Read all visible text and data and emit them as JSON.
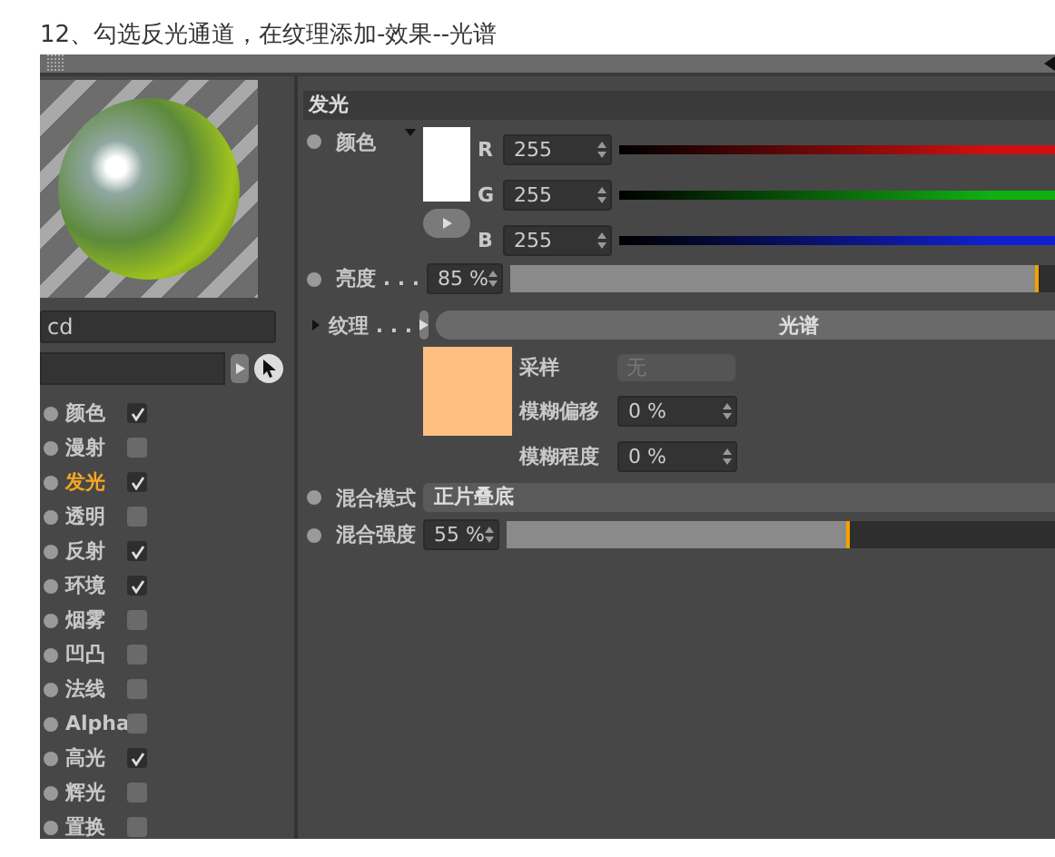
{
  "caption": "12、勾选反光通道，在纹理添加-效果--光谱",
  "material": {
    "name": "cd"
  },
  "channels": [
    {
      "label": "颜色",
      "checked": true,
      "selected": false
    },
    {
      "label": "漫射",
      "checked": false,
      "selected": false
    },
    {
      "label": "发光",
      "checked": true,
      "selected": true
    },
    {
      "label": "透明",
      "checked": false,
      "selected": false
    },
    {
      "label": "反射",
      "checked": true,
      "selected": false
    },
    {
      "label": "环境",
      "checked": true,
      "selected": false
    },
    {
      "label": "烟雾",
      "checked": false,
      "selected": false
    },
    {
      "label": "凹凸",
      "checked": false,
      "selected": false
    },
    {
      "label": "法线",
      "checked": false,
      "selected": false
    },
    {
      "label": "Alpha",
      "checked": false,
      "selected": false
    },
    {
      "label": "高光",
      "checked": true,
      "selected": false
    },
    {
      "label": "辉光",
      "checked": false,
      "selected": false
    },
    {
      "label": "置换",
      "checked": false,
      "selected": false
    }
  ],
  "section_title": "发光",
  "color": {
    "label": "颜色",
    "color": "#ffffff",
    "components": [
      {
        "label": "R",
        "value": "255",
        "color": "#d01010"
      },
      {
        "label": "G",
        "value": "255",
        "color": "#10b010"
      },
      {
        "label": "B",
        "value": "255",
        "color": "#1020d0"
      }
    ]
  },
  "brightness": {
    "label": "亮度 . . .",
    "value": "85 %",
    "level": 0.85
  },
  "texture": {
    "label": "纹理 . . .",
    "name": "光谱",
    "color": "#ffbf80",
    "fields": [
      {
        "kind": "select",
        "label": "采样",
        "value": "无",
        "disabled": true
      },
      {
        "kind": "number",
        "label": "模糊偏移",
        "value": "0 %",
        "disabled": false
      },
      {
        "kind": "number",
        "label": "模糊程度",
        "value": "0 %",
        "disabled": false
      }
    ]
  },
  "blend_mode": {
    "label": "混合模式",
    "value": "正片叠底"
  },
  "blend_strength": {
    "label": "混合强度",
    "value": "55 %",
    "level": 0.55
  }
}
